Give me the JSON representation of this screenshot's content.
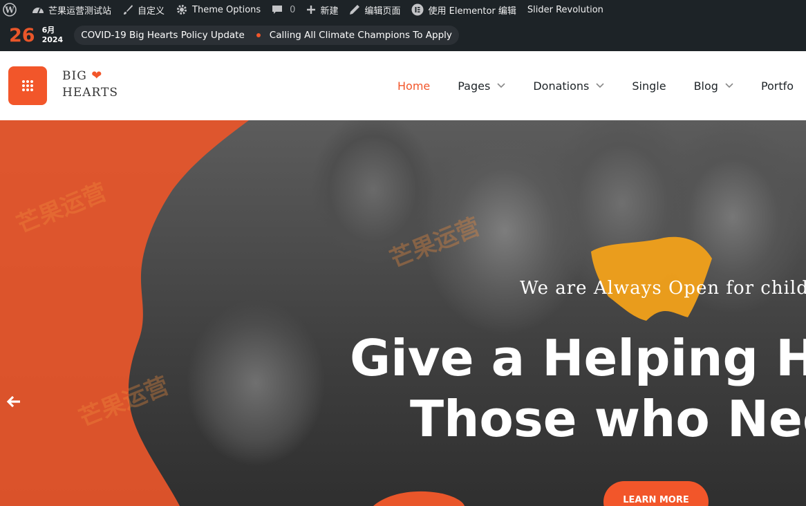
{
  "adminbar": {
    "site": "芒果运营测试站",
    "customize": "自定义",
    "theme_options": "Theme Options",
    "comments_count": "0",
    "new": "新建",
    "edit_page": "编辑页面",
    "elementor": "使用 Elementor 编辑",
    "slider": "Slider Revolution"
  },
  "topbar": {
    "day": "26",
    "month": "6月",
    "year": "2024",
    "news": [
      "COVID-19 Big Hearts Policy Update",
      "Calling All Climate Champions To Apply"
    ]
  },
  "logo": {
    "line1": "BIG",
    "line2": "HEARTS"
  },
  "nav": [
    {
      "label": "Home",
      "dropdown": false,
      "active": true
    },
    {
      "label": "Pages",
      "dropdown": true,
      "active": false
    },
    {
      "label": "Donations",
      "dropdown": true,
      "active": false
    },
    {
      "label": "Single",
      "dropdown": false,
      "active": false
    },
    {
      "label": "Blog",
      "dropdown": true,
      "active": false
    },
    {
      "label": "Portfo",
      "dropdown": false,
      "active": false
    }
  ],
  "hero": {
    "tagline": "We are Always Open for children",
    "headline_1": "Give a Helping Ha",
    "headline_2": "Those who Nee",
    "cta": "LEARN MORE"
  },
  "watermark": {
    "text": "芒果运营",
    "url": "mangoecom.com"
  },
  "colors": {
    "accent": "#f2562a",
    "dark": "#1d2327",
    "paint": "#f2a11a"
  }
}
